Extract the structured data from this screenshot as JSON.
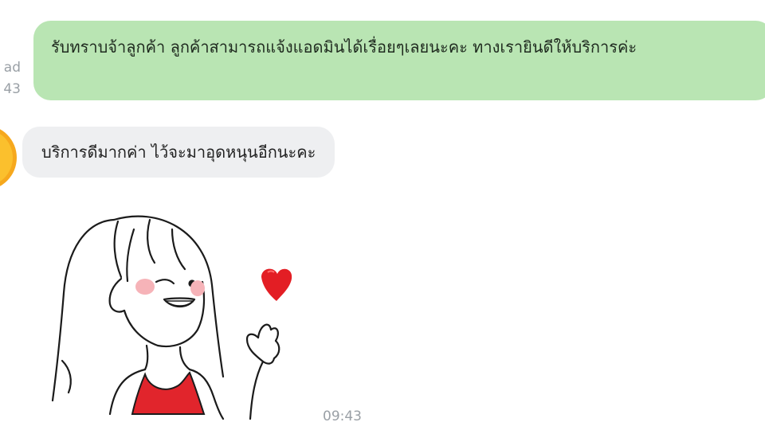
{
  "conversation": {
    "outgoing_message": {
      "text": "รับทราบจ้าลูกค้า ลูกค้าสามารถแจ้งแอดมินได้เรื่อยๆเลยนะคะ ทางเรายินดีให้บริการค่ะ",
      "status_partial": "ad",
      "time_partial": "43"
    },
    "incoming_message": {
      "text": "บริการดีมากค่า ไว้จะมาอุดหนุนอีกนะคะ"
    },
    "sticker_message": {
      "sticker_name": "girl-finger-heart-sticker",
      "time": "09:43"
    }
  },
  "colors": {
    "outgoing_bubble": "#b9e5b3",
    "incoming_bubble": "#eeeff1",
    "meta_text": "#9aa0a6",
    "sticker_heart": "#e31e24",
    "sticker_dress": "#e1252c",
    "sticker_cheek": "#f6b3b8"
  },
  "icons": {
    "avatar": "heart-face-emoji-icon"
  }
}
